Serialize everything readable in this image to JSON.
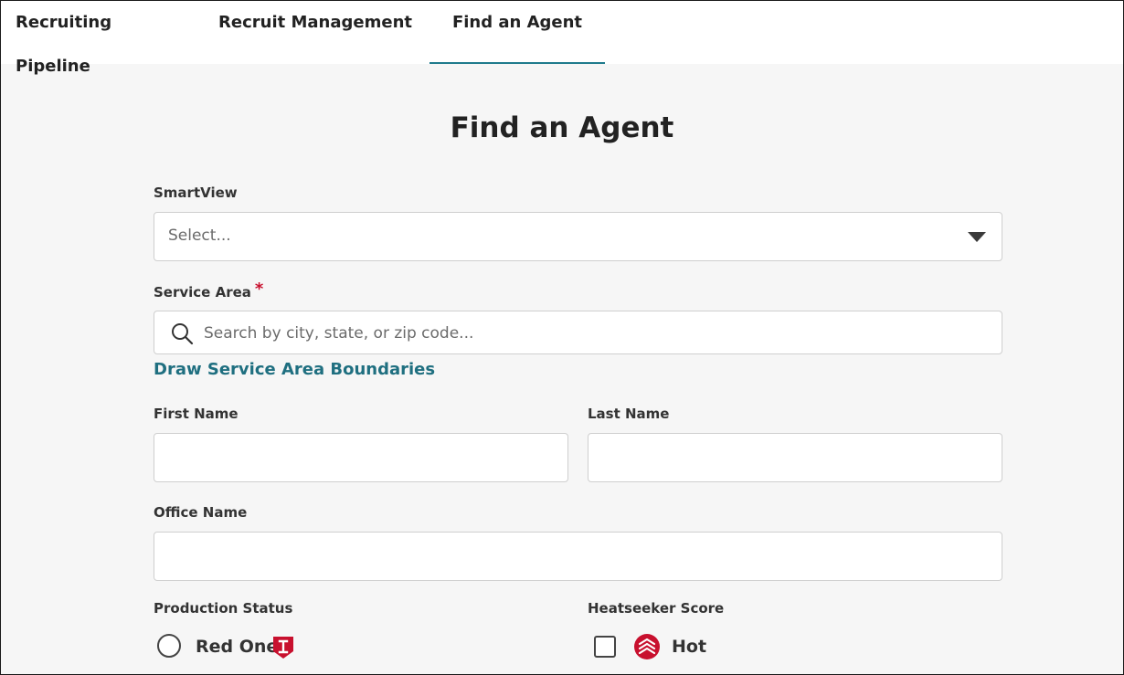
{
  "tabs": [
    {
      "label": "Recruiting Pipeline",
      "active": false
    },
    {
      "label": "Recruit Management",
      "active": false
    },
    {
      "label": "Find an Agent",
      "active": true
    }
  ],
  "page": {
    "title": "Find an Agent"
  },
  "smartview": {
    "label": "SmartView",
    "placeholder": "Select..."
  },
  "service_area": {
    "label": "Service Area",
    "required_marker": "*",
    "placeholder": "Search by city, state, or zip code...",
    "draw_link": "Draw Service Area Boundaries"
  },
  "first_name": {
    "label": "First Name",
    "value": ""
  },
  "last_name": {
    "label": "Last Name",
    "value": ""
  },
  "office_name": {
    "label": "Office Name",
    "value": ""
  },
  "production_status": {
    "label": "Production Status",
    "options": [
      {
        "label": "Red One",
        "badge_icon": "red-shield-icon",
        "selected": false
      }
    ]
  },
  "heatseeker_score": {
    "label": "Heatseeker Score",
    "options": [
      {
        "label": "Hot",
        "icon": "hot-flame-icon",
        "checked": false
      }
    ]
  },
  "colors": {
    "accent": "#1f7a8c",
    "link": "#1f6f80",
    "required": "#c8102e",
    "badge_red": "#c8102e"
  }
}
